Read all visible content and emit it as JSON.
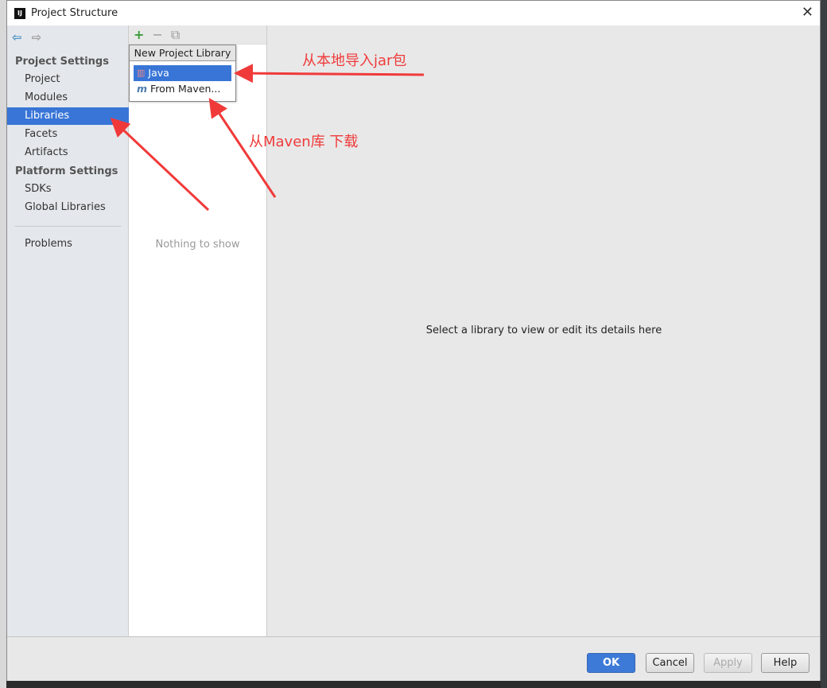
{
  "window": {
    "title": "Project Structure",
    "logo": "IJ"
  },
  "sidebar": {
    "sections": [
      {
        "label": "Project Settings"
      },
      {
        "label": "Platform Settings"
      }
    ],
    "items": [
      {
        "label": "Project"
      },
      {
        "label": "Modules"
      },
      {
        "label": "Libraries",
        "selected": true
      },
      {
        "label": "Facets"
      },
      {
        "label": "Artifacts"
      },
      {
        "label": "SDKs"
      },
      {
        "label": "Global Libraries"
      },
      {
        "label": "Problems"
      }
    ]
  },
  "list": {
    "empty_text": "Nothing to show"
  },
  "popup": {
    "header": "New Project Library",
    "items": [
      {
        "label": "Java",
        "icon": "library-books-icon",
        "selected": true
      },
      {
        "label": "From Maven...",
        "icon": "maven-m-icon"
      }
    ]
  },
  "detail": {
    "hint": "Select a library to view or edit its details here"
  },
  "footer": {
    "ok": "OK",
    "cancel": "Cancel",
    "apply": "Apply",
    "help": "Help"
  },
  "annotations": {
    "java": "从本地导入jar包",
    "maven": "从Maven库 下载",
    "color": "#f03a3a"
  }
}
